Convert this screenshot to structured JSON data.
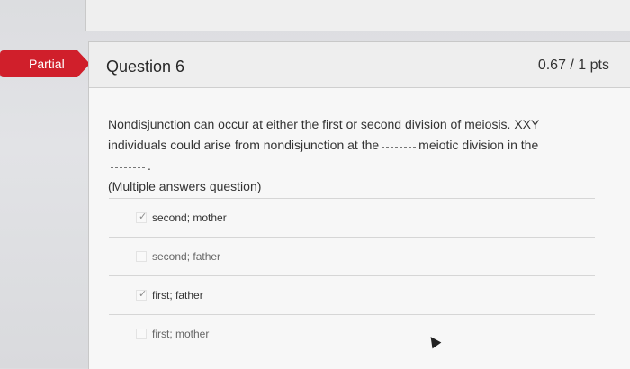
{
  "badge": {
    "label": "Partial",
    "color": "#d01f2b"
  },
  "question": {
    "title": "Question 6",
    "score": "0.67 / 1 pts",
    "text_line1": "Nondisjunction can occur at either the first or second division of meiosis. XXY",
    "text_line2_a": "individuals could arise from nondisjunction at the",
    "text_line2_b": "meiotic division in the",
    "text_line2_end": ".",
    "text_line3": "(Multiple answers question)"
  },
  "answers": [
    {
      "label": "second; mother",
      "selected": true,
      "icon": "check-icon"
    },
    {
      "label": "second; father",
      "selected": false
    },
    {
      "label": "first; father",
      "selected": true,
      "icon": "check-icon"
    },
    {
      "label": "first; mother",
      "selected": false
    }
  ],
  "icons": {
    "tick": "✓"
  }
}
